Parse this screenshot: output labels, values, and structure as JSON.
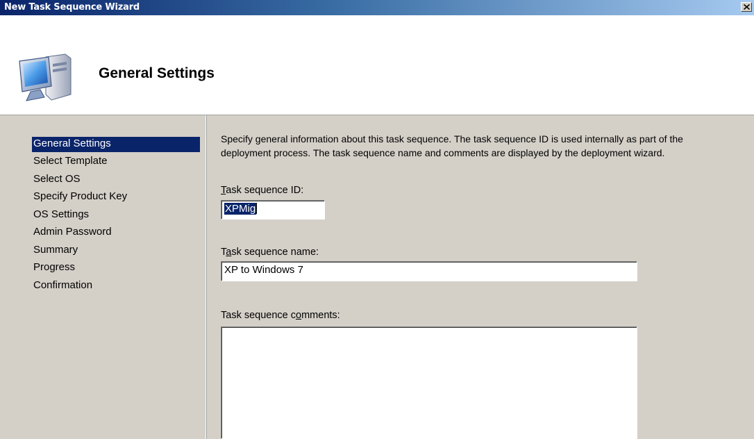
{
  "window": {
    "title": "New Task Sequence Wizard",
    "close_glyph": "X"
  },
  "header": {
    "title": "General Settings",
    "icon": "computer-monitor-icon"
  },
  "nav": {
    "items": [
      {
        "label": "General Settings",
        "selected": true
      },
      {
        "label": "Select Template",
        "selected": false
      },
      {
        "label": "Select OS",
        "selected": false
      },
      {
        "label": "Specify Product Key",
        "selected": false
      },
      {
        "label": "OS Settings",
        "selected": false
      },
      {
        "label": "Admin Password",
        "selected": false
      },
      {
        "label": "Summary",
        "selected": false
      },
      {
        "label": "Progress",
        "selected": false
      },
      {
        "label": "Confirmation",
        "selected": false
      }
    ]
  },
  "main": {
    "description_line1": "Specify general information about this task sequence.  The task sequence ID is used internally as part of the",
    "description_line2": "deployment process.  The task sequence name and comments are displayed by the deployment wizard.",
    "fields": {
      "id": {
        "label_accel": "T",
        "label_rest": "ask sequence ID:",
        "value": "XPMig"
      },
      "name": {
        "label_pre": "T",
        "label_accel": "a",
        "label_rest": "sk sequence name:",
        "value": "XP to Windows 7"
      },
      "comments": {
        "label_pre": "Task sequence c",
        "label_accel": "o",
        "label_rest": "mments:",
        "value": ""
      }
    }
  },
  "colors": {
    "title_gradient_start": "#0a246a",
    "title_gradient_end": "#a6caf0",
    "selection": "#0a246a",
    "dialog_face": "#d4d0c8"
  }
}
